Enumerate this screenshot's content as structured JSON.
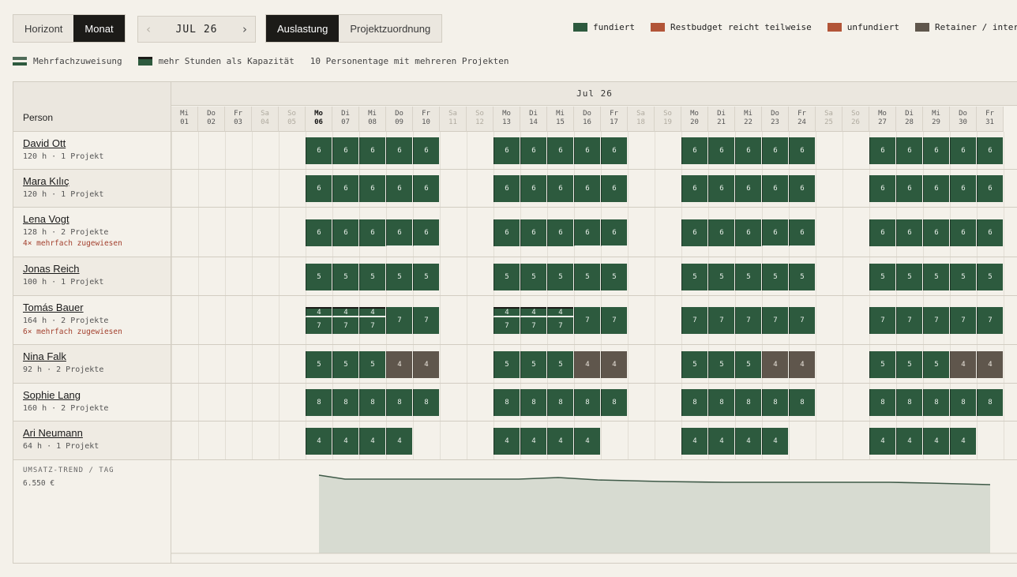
{
  "view_tabs": [
    {
      "label": "Horizont",
      "active": false
    },
    {
      "label": "Monat",
      "active": true
    }
  ],
  "month_nav": {
    "prev": "‹",
    "label": "JUL 26",
    "next": "›"
  },
  "mode_tabs": [
    {
      "label": "Auslastung",
      "active": true
    },
    {
      "label": "Projektzuordnung",
      "active": false
    }
  ],
  "legend": [
    {
      "label": "fundiert",
      "color": "#2d5a3e"
    },
    {
      "label": "Restbudget reicht teilweise",
      "color": "#b25538"
    },
    {
      "label": "unfundiert",
      "color": "#b25538"
    },
    {
      "label": "Retainer / intern",
      "color": "#5f564c"
    }
  ],
  "legend2": {
    "multi": "Mehrfachzuweisung",
    "over": "mehr Stunden als Kapazität",
    "summary": "10 Personentage mit mehreren Projekten"
  },
  "grid": {
    "person_header": "Person",
    "month_label": "Jul 26",
    "days": [
      {
        "dow": "Mi",
        "d": "01",
        "we": false
      },
      {
        "dow": "Do",
        "d": "02",
        "we": false
      },
      {
        "dow": "Fr",
        "d": "03",
        "we": false
      },
      {
        "dow": "Sa",
        "d": "04",
        "we": true
      },
      {
        "dow": "So",
        "d": "05",
        "we": true
      },
      {
        "dow": "Mo",
        "d": "06",
        "we": false,
        "today": true
      },
      {
        "dow": "Di",
        "d": "07",
        "we": false
      },
      {
        "dow": "Mi",
        "d": "08",
        "we": false
      },
      {
        "dow": "Do",
        "d": "09",
        "we": false
      },
      {
        "dow": "Fr",
        "d": "10",
        "we": false
      },
      {
        "dow": "Sa",
        "d": "11",
        "we": true
      },
      {
        "dow": "So",
        "d": "12",
        "we": true
      },
      {
        "dow": "Mo",
        "d": "13",
        "we": false
      },
      {
        "dow": "Di",
        "d": "14",
        "we": false
      },
      {
        "dow": "Mi",
        "d": "15",
        "we": false
      },
      {
        "dow": "Do",
        "d": "16",
        "we": false
      },
      {
        "dow": "Fr",
        "d": "17",
        "we": false
      },
      {
        "dow": "Sa",
        "d": "18",
        "we": true
      },
      {
        "dow": "So",
        "d": "19",
        "we": true
      },
      {
        "dow": "Mo",
        "d": "20",
        "we": false
      },
      {
        "dow": "Di",
        "d": "21",
        "we": false
      },
      {
        "dow": "Mi",
        "d": "22",
        "we": false
      },
      {
        "dow": "Do",
        "d": "23",
        "we": false
      },
      {
        "dow": "Fr",
        "d": "24",
        "we": false
      },
      {
        "dow": "Sa",
        "d": "25",
        "we": true
      },
      {
        "dow": "So",
        "d": "26",
        "we": true
      },
      {
        "dow": "Mo",
        "d": "27",
        "we": false
      },
      {
        "dow": "Di",
        "d": "28",
        "we": false
      },
      {
        "dow": "Mi",
        "d": "29",
        "we": false
      },
      {
        "dow": "Do",
        "d": "30",
        "we": false
      },
      {
        "dow": "Fr",
        "d": "31",
        "we": false
      }
    ],
    "people": [
      {
        "name": "David Ott",
        "meta": "120 h · 1 Projekt",
        "warn": "",
        "weekA": [
          6,
          6,
          6,
          6,
          6
        ],
        "weekB": [
          6,
          6,
          6,
          6,
          6
        ],
        "split": [],
        "retainer": []
      },
      {
        "name": "Mara Kılıç",
        "meta": "120 h · 1 Projekt",
        "warn": "",
        "weekA": [
          6,
          6,
          6,
          6,
          6
        ],
        "weekB": [
          6,
          6,
          6,
          6,
          6
        ],
        "split": [],
        "retainer": []
      },
      {
        "name": "Lena Vogt",
        "meta": "128 h · 2 Projekte",
        "warn": "4× mehrfach zugewiesen",
        "weekA": [
          6,
          6,
          6,
          6,
          6
        ],
        "weekB": [
          6,
          6,
          6,
          6,
          6
        ],
        "split": [
          3,
          4
        ],
        "retainer": []
      },
      {
        "name": "Jonas Reich",
        "meta": "100 h · 1 Projekt",
        "warn": "",
        "weekA": [
          5,
          5,
          5,
          5,
          5
        ],
        "weekB": [
          5,
          5,
          5,
          5,
          5
        ],
        "split": [],
        "retainer": []
      },
      {
        "name": "Tomás Bauer",
        "meta": "164 h · 2 Projekte",
        "warn": "6× mehrfach zugewiesen",
        "weekA": [
          7,
          7,
          7,
          7,
          7
        ],
        "weekB": [
          7,
          7,
          7,
          7,
          7
        ],
        "double": [
          0,
          1,
          2
        ],
        "doubleTop": 4,
        "split": [],
        "retainer": []
      },
      {
        "name": "Nina Falk",
        "meta": "92 h · 2 Projekte",
        "warn": "",
        "weekA": [
          5,
          5,
          5,
          4,
          4
        ],
        "weekB": [
          5,
          5,
          5,
          4,
          4
        ],
        "split": [],
        "retainer": [
          3,
          4
        ]
      },
      {
        "name": "Sophie Lang",
        "meta": "160 h · 2 Projekte",
        "warn": "",
        "weekA": [
          8,
          8,
          8,
          8,
          8
        ],
        "weekB": [
          8,
          8,
          8,
          8,
          8
        ],
        "split": [],
        "retainer": []
      },
      {
        "name": "Ari Neumann",
        "meta": "64 h · 1 Projekt",
        "warn": "",
        "weekA": [
          4,
          4,
          4,
          4
        ],
        "weekB": [
          4,
          4,
          4,
          4
        ],
        "split": [],
        "retainer": []
      }
    ]
  },
  "trend": {
    "title": "UMSATZ-TREND / TAG",
    "value": "6.550 €",
    "fill": "#d7dbd1",
    "line": "#3f5a48"
  }
}
